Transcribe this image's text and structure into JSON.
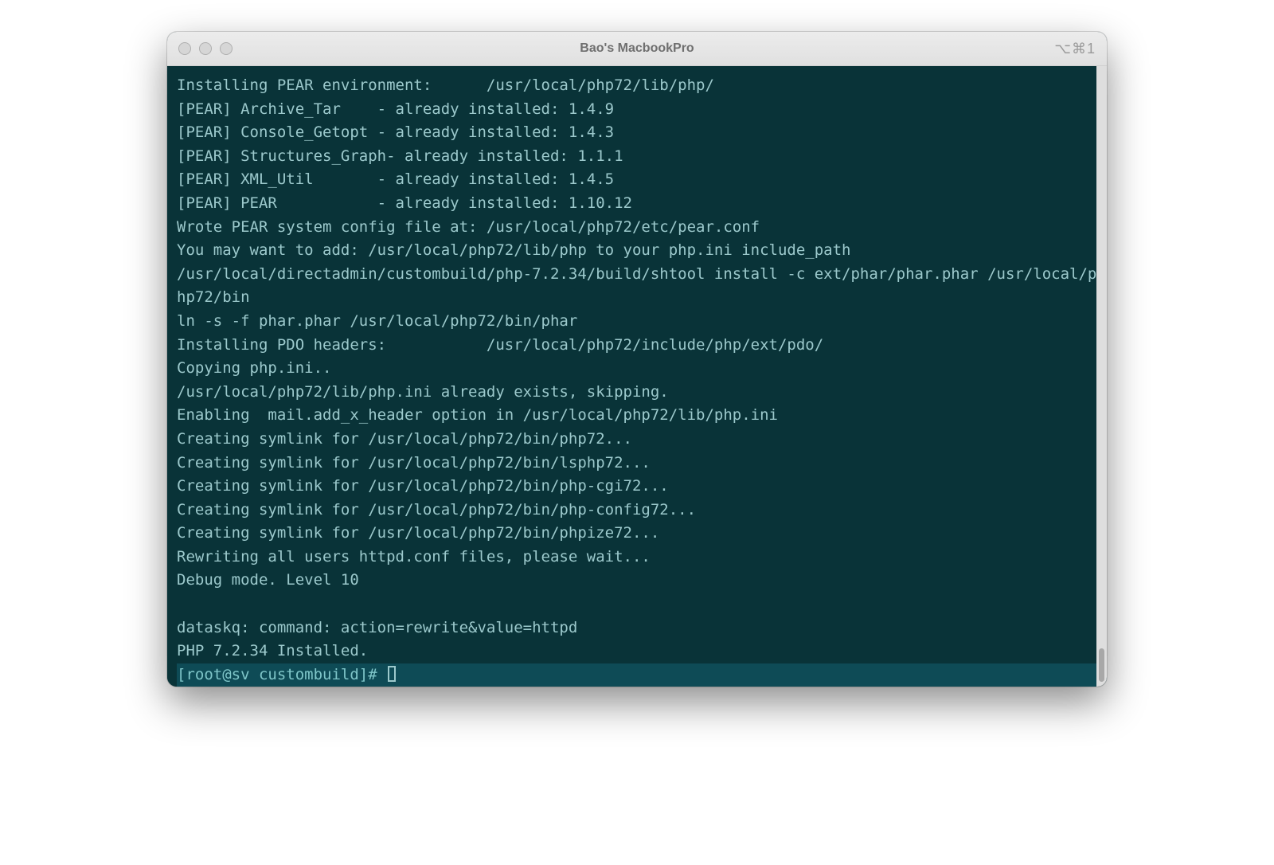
{
  "window": {
    "title": "Bao's MacbookPro",
    "shortcut": "⌥⌘1"
  },
  "terminal": {
    "lines": [
      "Installing PEAR environment:      /usr/local/php72/lib/php/",
      "[PEAR] Archive_Tar    - already installed: 1.4.9",
      "[PEAR] Console_Getopt - already installed: 1.4.3",
      "[PEAR] Structures_Graph- already installed: 1.1.1",
      "[PEAR] XML_Util       - already installed: 1.4.5",
      "[PEAR] PEAR           - already installed: 1.10.12",
      "Wrote PEAR system config file at: /usr/local/php72/etc/pear.conf",
      "You may want to add: /usr/local/php72/lib/php to your php.ini include_path",
      "/usr/local/directadmin/custombuild/php-7.2.34/build/shtool install -c ext/phar/phar.phar /usr/local/p",
      "hp72/bin",
      "ln -s -f phar.phar /usr/local/php72/bin/phar",
      "Installing PDO headers:           /usr/local/php72/include/php/ext/pdo/",
      "Copying php.ini..",
      "/usr/local/php72/lib/php.ini already exists, skipping.",
      "Enabling  mail.add_x_header option in /usr/local/php72/lib/php.ini",
      "Creating symlink for /usr/local/php72/bin/php72...",
      "Creating symlink for /usr/local/php72/bin/lsphp72...",
      "Creating symlink for /usr/local/php72/bin/php-cgi72...",
      "Creating symlink for /usr/local/php72/bin/php-config72...",
      "Creating symlink for /usr/local/php72/bin/phpize72...",
      "Rewriting all users httpd.conf files, please wait...",
      "Debug mode. Level 10",
      "",
      "dataskq: command: action=rewrite&value=httpd",
      "PHP 7.2.34 Installed."
    ],
    "prompt": "[root@sv custombuild]# "
  }
}
